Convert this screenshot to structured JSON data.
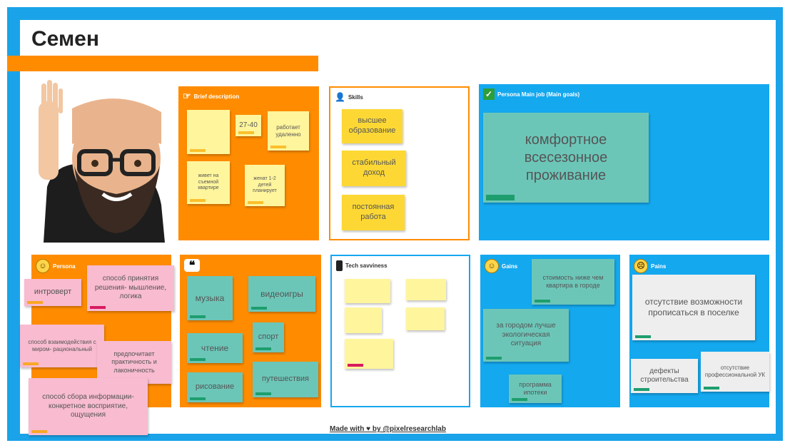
{
  "persona": {
    "name": "Семен"
  },
  "brief": {
    "title": "Brief description",
    "notes": [
      "",
      "27-40",
      "работает удаленно",
      "живет на съемной квартире",
      "женат 1-2 детей планирует"
    ]
  },
  "skills": {
    "title": "Skills",
    "notes": [
      "высшее образование",
      "стабильный доход",
      "постоянная работа"
    ]
  },
  "goals": {
    "title": "Persona Main job (Main goals)",
    "note": "комфортное всесезонное проживание"
  },
  "personality": {
    "title": "Persona",
    "notes": [
      "интроверт",
      "способ принятия решения- мышление, логика",
      "способ взаимодействия с миром- рациональный",
      "предпочитает практичность и лаконичность",
      "способ сбора информации- конкретное восприятие, ощущения"
    ]
  },
  "hobbies": {
    "notes": [
      "музыка",
      "видеоигры",
      "чтение",
      "спорт",
      "рисование",
      "путешествия"
    ]
  },
  "tech": {
    "title": "Tech savviness"
  },
  "gains": {
    "title": "Gains",
    "notes": [
      "стоимость ниже чем квартира в городе",
      "за городом лучше экологическая ситуация",
      "программа ипотеки"
    ]
  },
  "pains": {
    "title": "Pains",
    "notes": [
      "отсутствие возможности прописаться в поселке",
      "дефекты строительства",
      "отсутствие профессиональной УК"
    ]
  },
  "footer": {
    "text": "Made with ♥ by @pixelresearchlab"
  },
  "colors": {
    "accent_blue": "#14a8ef",
    "accent_orange": "#ff8c00"
  }
}
